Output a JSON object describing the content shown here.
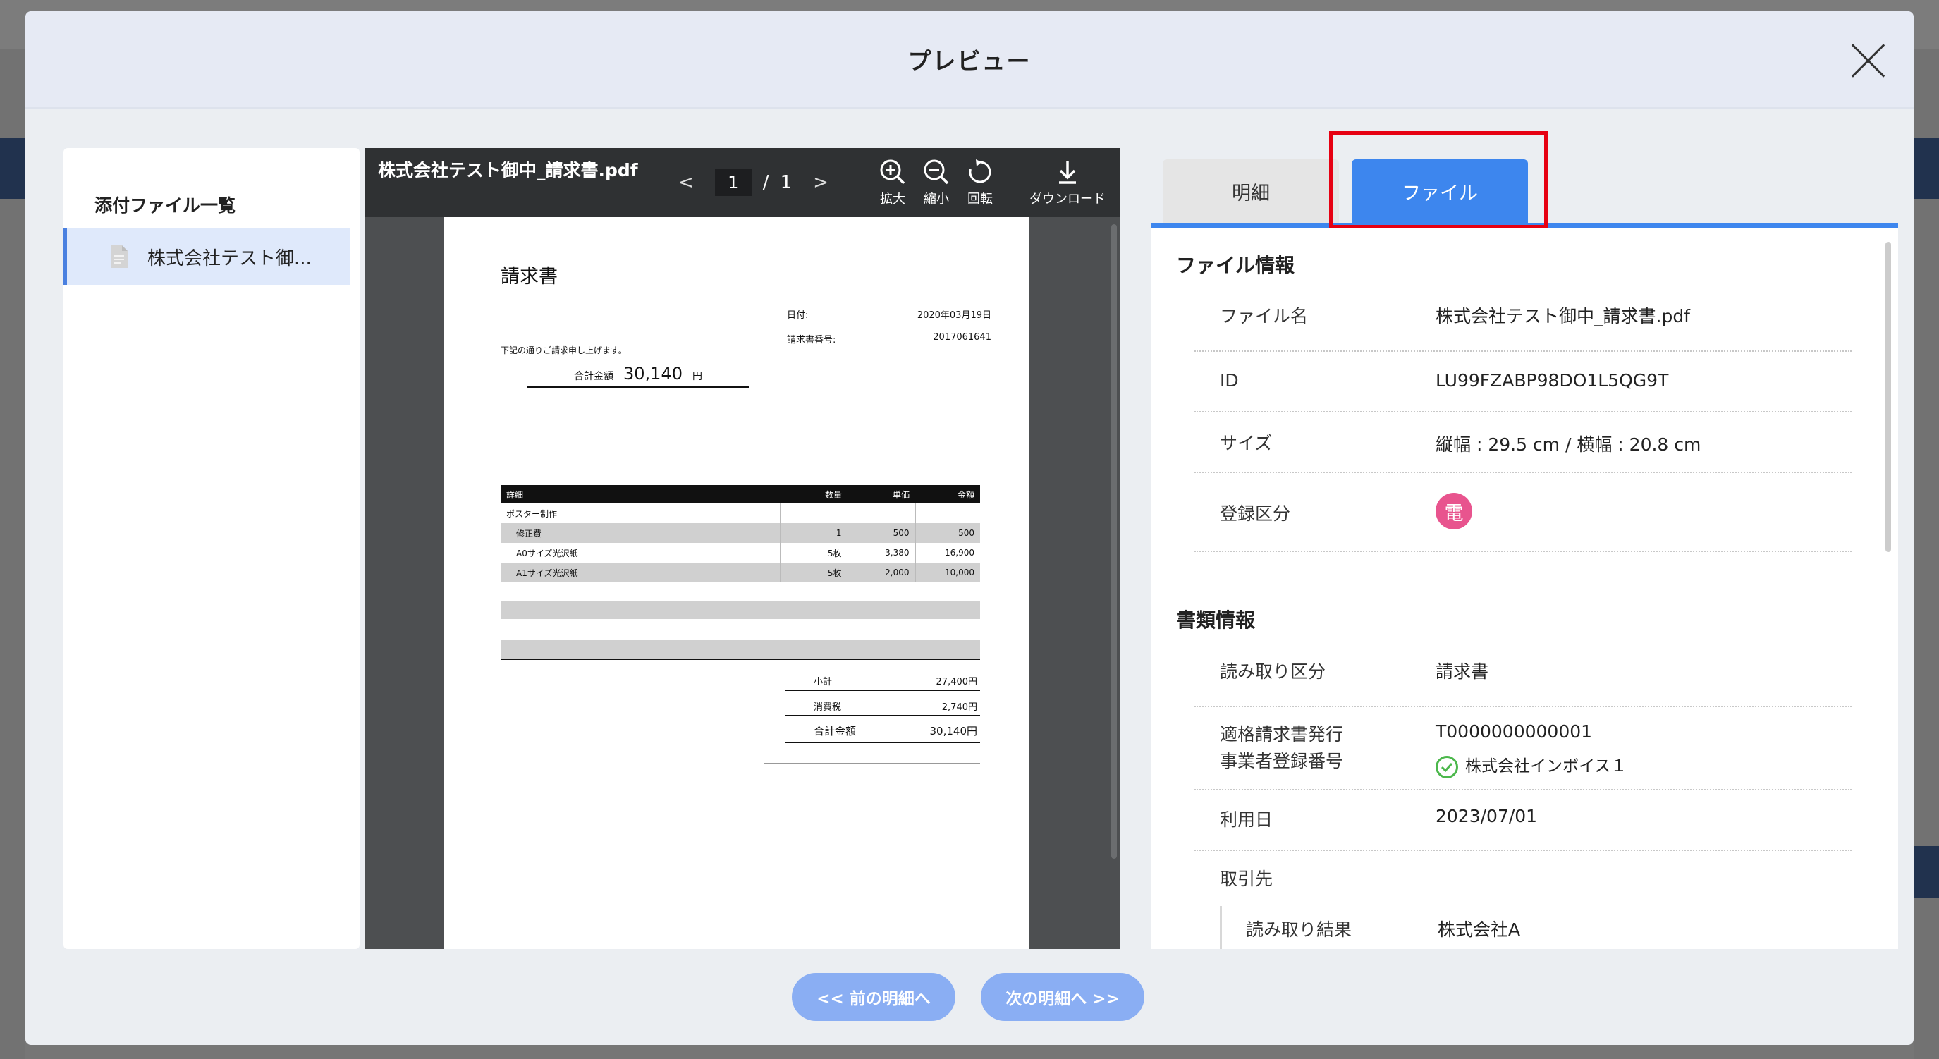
{
  "modal": {
    "title": "プレビュー"
  },
  "file_list": {
    "title": "添付ファイル一覧",
    "items": [
      {
        "label": "株式会社テスト御..."
      }
    ]
  },
  "viewer": {
    "filename": "株式会社テスト御中_請求書.pdf",
    "page_current": "1",
    "page_sep": "/",
    "page_total": "1",
    "prev_arrow": "<",
    "next_arrow": ">",
    "tools": {
      "zoom_in": "拡大",
      "zoom_out": "縮小",
      "rotate": "回転",
      "download": "ダウンロード"
    }
  },
  "invoice": {
    "title": "請求書",
    "date_label": "日付:",
    "date_value": "2020年03月19日",
    "number_label": "請求書番号:",
    "number_value": "2017061641",
    "greeting": "下記の通りご請求申し上げます。",
    "total_label": "合計金額",
    "total_amount": "30,140",
    "total_unit": "円",
    "headers": [
      "詳細",
      "数量",
      "単価",
      "金額"
    ],
    "group_label": "ポスター制作",
    "rows": [
      {
        "item": "修正費",
        "qty": "1",
        "unit_price": "500",
        "amount": "500"
      },
      {
        "item": "A0サイズ光沢紙",
        "qty": "5枚",
        "unit_price": "3,380",
        "amount": "16,900"
      },
      {
        "item": "A1サイズ光沢紙",
        "qty": "5枚",
        "unit_price": "2,000",
        "amount": "10,000"
      }
    ],
    "subtotal_label": "小計",
    "subtotal_value": "27,400円",
    "tax_label": "消費税",
    "tax_value": "2,740円",
    "grand_label": "合計金額",
    "grand_value": "30,140円"
  },
  "tabs": {
    "detail": "明細",
    "file": "ファイル"
  },
  "file_info": {
    "title": "ファイル情報",
    "name_label": "ファイル名",
    "name_value": "株式会社テスト御中_請求書.pdf",
    "id_label": "ID",
    "id_value": "LU99FZABP98DO1L5QG9T",
    "size_label": "サイズ",
    "size_value": "縦幅 : 29.5 cm / 横幅 : 20.8 cm",
    "reg_label": "登録区分",
    "reg_badge": "電"
  },
  "doc_info": {
    "title": "書類情報",
    "read_type_label": "読み取り区分",
    "read_type_value": "請求書",
    "invoice_reg_label_1": "適格請求書発行",
    "invoice_reg_label_2": "事業者登録番号",
    "invoice_reg_value": "T0000000000001",
    "invoice_reg_company": "株式会社インボイス１",
    "use_date_label": "利用日",
    "use_date_value": "2023/07/01",
    "partner_label": "取引先",
    "read_result_label": "読み取り結果",
    "read_result_value": "株式会社A"
  },
  "nav": {
    "prev": "<< 前の明細へ",
    "next": "次の明細へ >>"
  },
  "colors": {
    "accent": "#3d86ee",
    "highlight": "#e60012",
    "badge": "#e8548e",
    "nav_button": "#8aaef3"
  }
}
